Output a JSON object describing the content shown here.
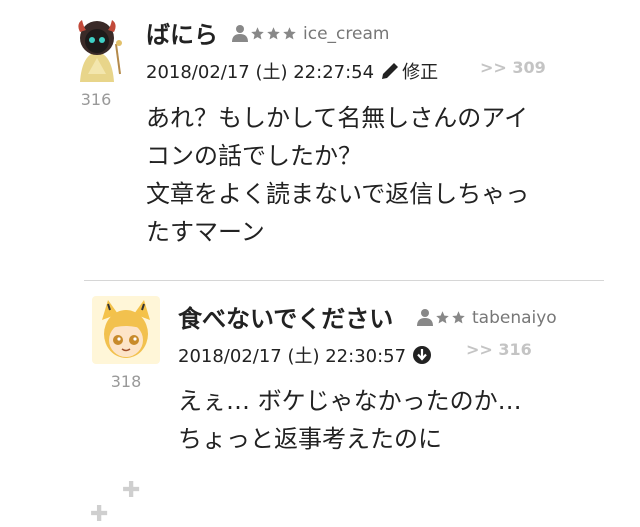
{
  "posts": [
    {
      "post_number": "316",
      "username": "ばにら",
      "user_id": "ice_cream",
      "timestamp": "2018/02/17 (土) 22:27:54",
      "edit_label": "修正",
      "reply_ref": ">> 309",
      "body_lines": [
        "あれ？もしかして名無しさんのアイ",
        "コンの話でしたか？",
        "文章をよく読まないで返信しちゃっ",
        "たすマーン"
      ]
    },
    {
      "post_number": "318",
      "username": "食べないでください",
      "user_id": "tabenaiyo",
      "timestamp": "2018/02/17 (土) 22:30:57",
      "reply_ref": ">> 316",
      "body_lines": [
        "えぇ… ボケじゃなかったのか…",
        "ちょっと返事考えたのに"
      ]
    }
  ],
  "icons": {
    "rank": "person-star-rank-icon",
    "edit": "pencil-icon",
    "download": "circle-arrow-down-icon",
    "expand": "plus-icon"
  },
  "colors": {
    "text": "#222222",
    "muted": "#999999",
    "reference": "#c4c4c4",
    "divider": "#d6d6d6"
  }
}
